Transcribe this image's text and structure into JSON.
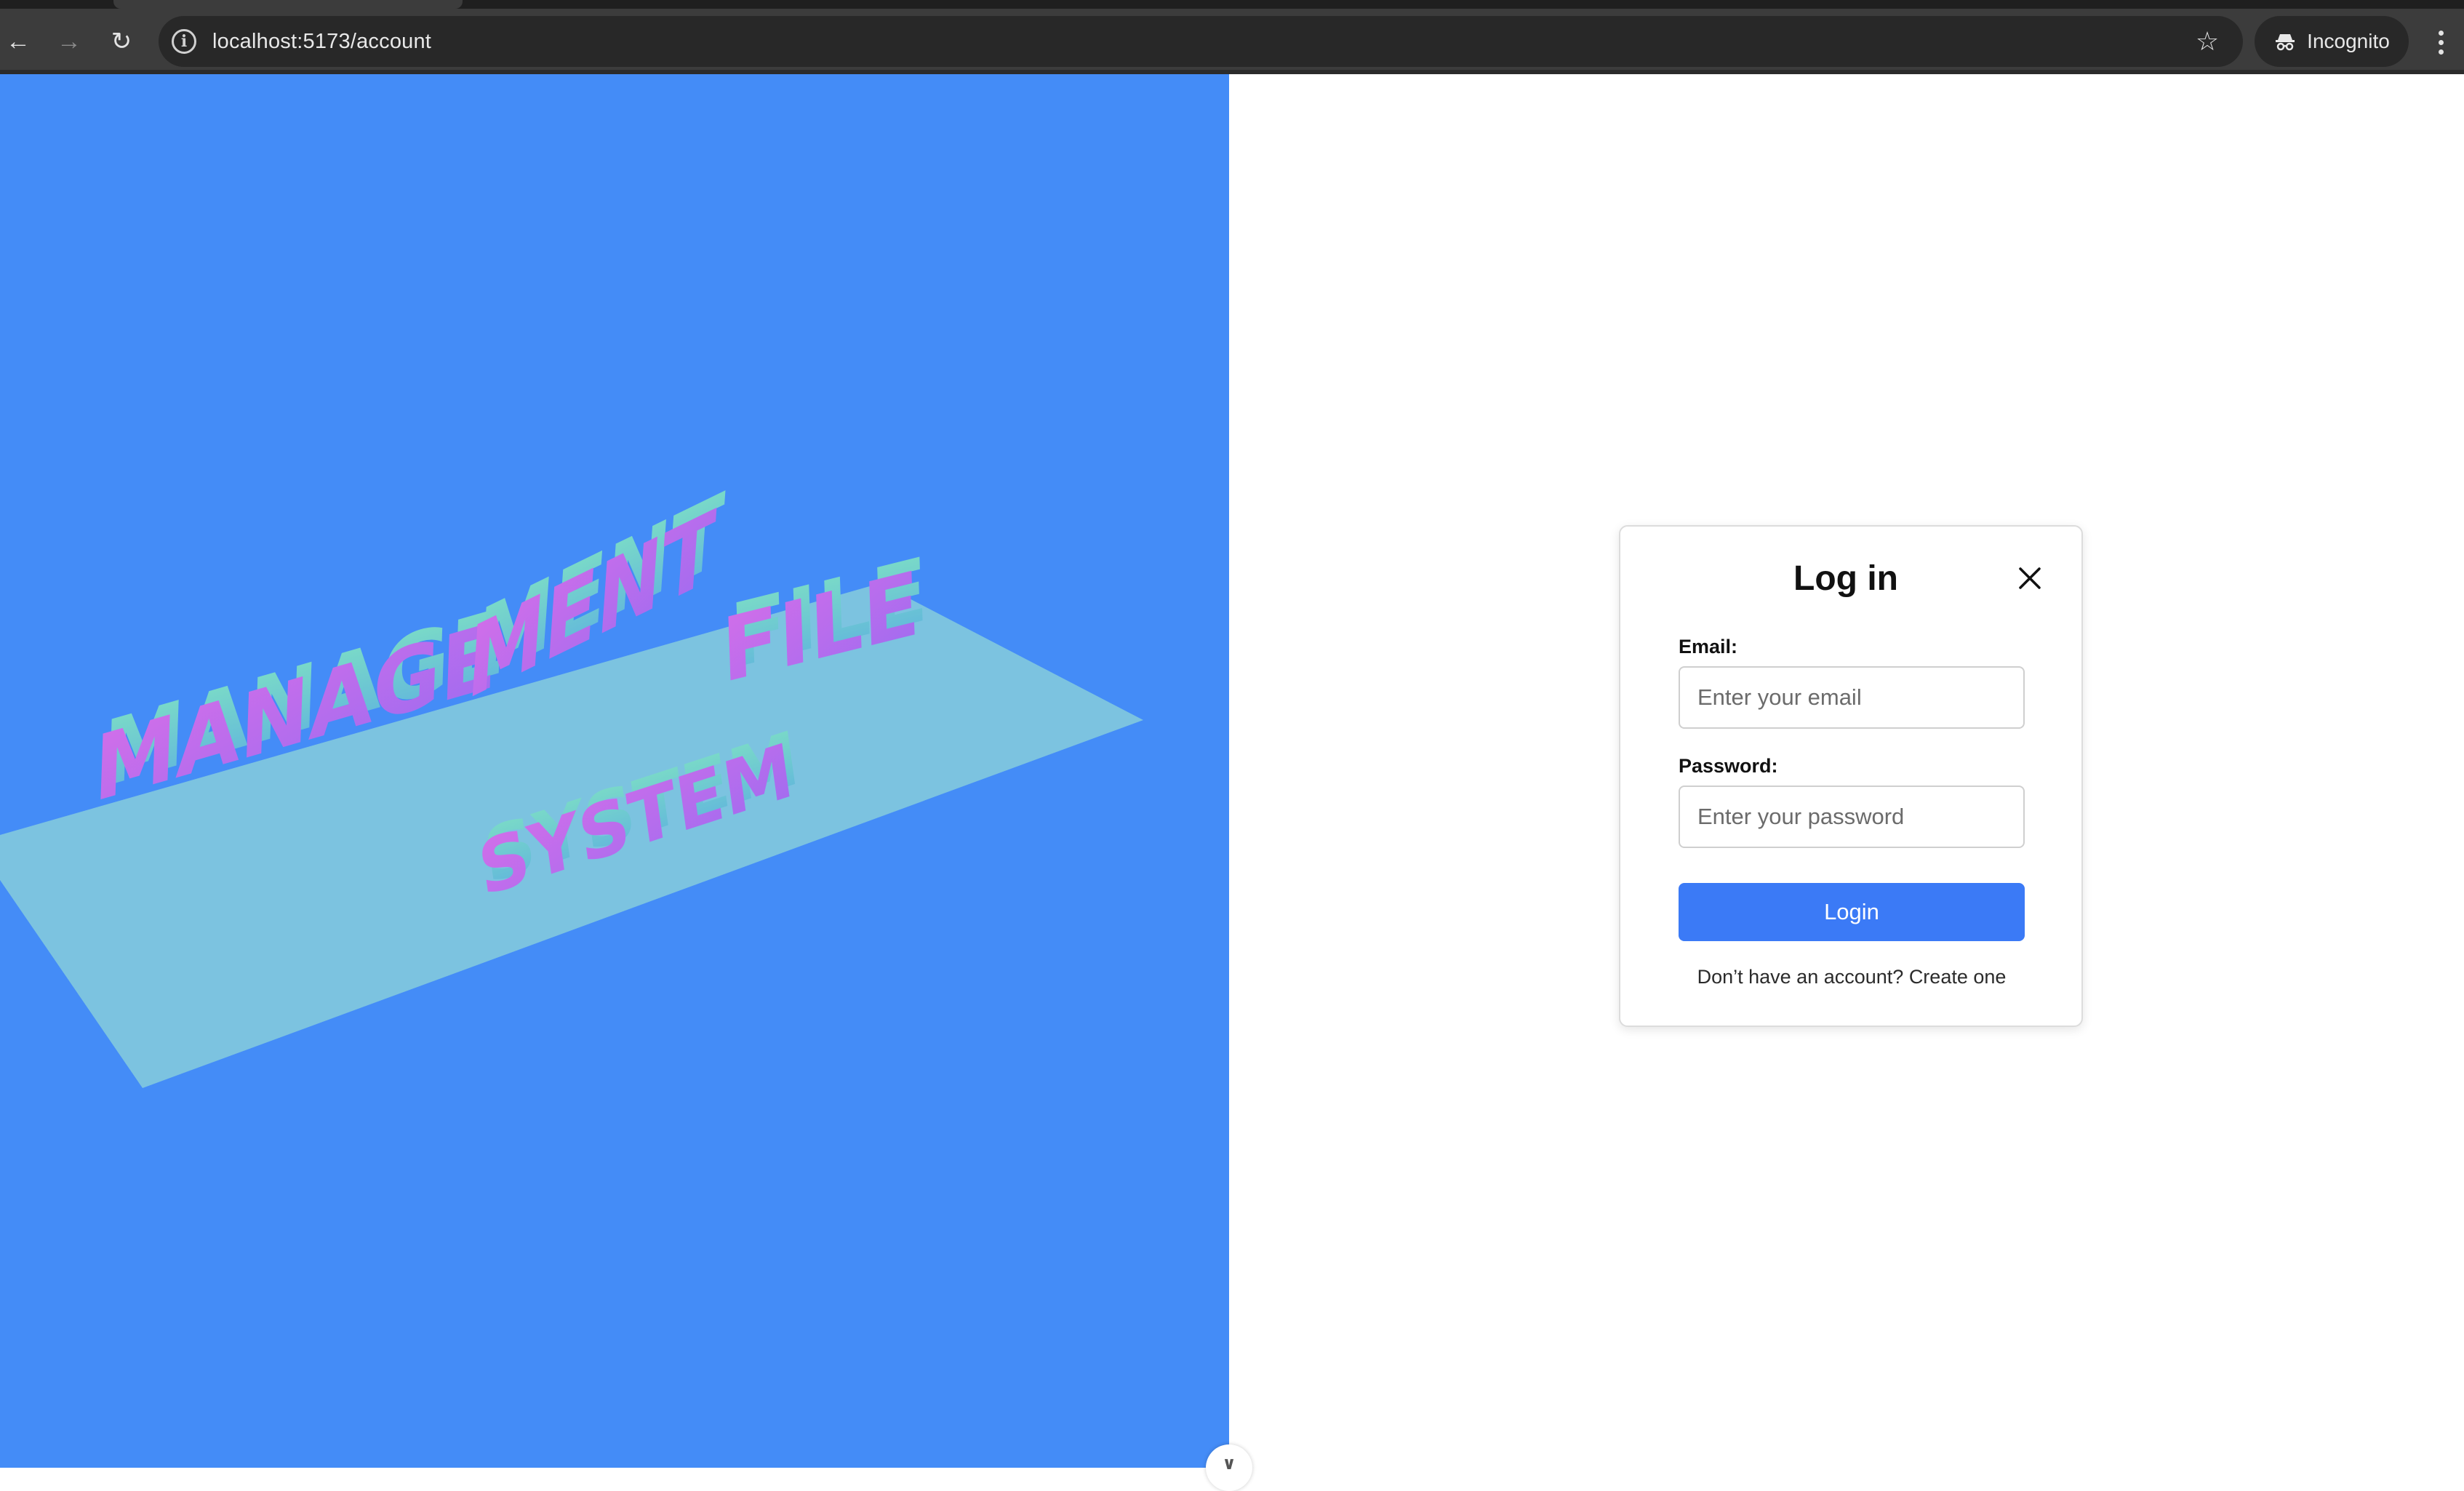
{
  "browser": {
    "url": "localhost:5173/account",
    "profile_label": "Incognito",
    "icons": {
      "back": "back-arrow-icon",
      "forward": "forward-arrow-icon",
      "reload": "reload-icon",
      "site_info": "info-icon",
      "bookmark": "star-icon",
      "incognito": "incognito-icon",
      "menu": "kebab-menu-icon"
    }
  },
  "scene": {
    "text_top": [
      "MANAGE",
      "MENT",
      "FILE"
    ],
    "text_bottom": "SYSTEM",
    "colors": {
      "background": "#448cf7",
      "plane": "#7cc3e0",
      "letter_face": "#c66bea",
      "letter_side": "#6fd6c6"
    }
  },
  "login": {
    "title": "Log in",
    "email_label": "Email:",
    "email_placeholder": "Enter your email",
    "email_value": "",
    "password_label": "Password:",
    "password_placeholder": "Enter your password",
    "password_value": "",
    "submit_label": "Login",
    "signup_prompt": "Don’t have an account?",
    "signup_link": "Create one",
    "accent": "#3b7af6"
  }
}
